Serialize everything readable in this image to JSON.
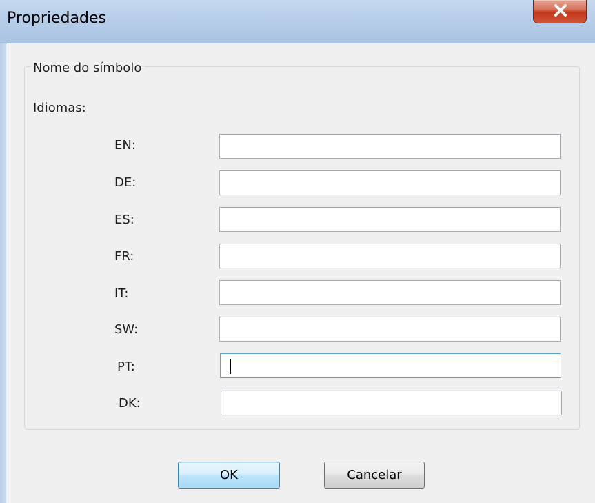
{
  "window": {
    "title": "Propriedades",
    "close_symbol": "close-icon"
  },
  "group": {
    "legend": "Nome do símbolo",
    "languages_label": "Idiomas:"
  },
  "languages": [
    {
      "code": "EN:",
      "value": ""
    },
    {
      "code": "DE:",
      "value": ""
    },
    {
      "code": "ES:",
      "value": ""
    },
    {
      "code": "FR:",
      "value": ""
    },
    {
      "code": "IT:",
      "value": ""
    },
    {
      "code": "SW:",
      "value": ""
    },
    {
      "code": "PT:",
      "value": "",
      "focused": true
    },
    {
      "code": "DK:",
      "value": ""
    }
  ],
  "buttons": {
    "ok_label": "OK",
    "cancel_label": "Cancelar"
  },
  "colors": {
    "focus_border": "#5aa4d8",
    "close_button": "#c2391c"
  }
}
